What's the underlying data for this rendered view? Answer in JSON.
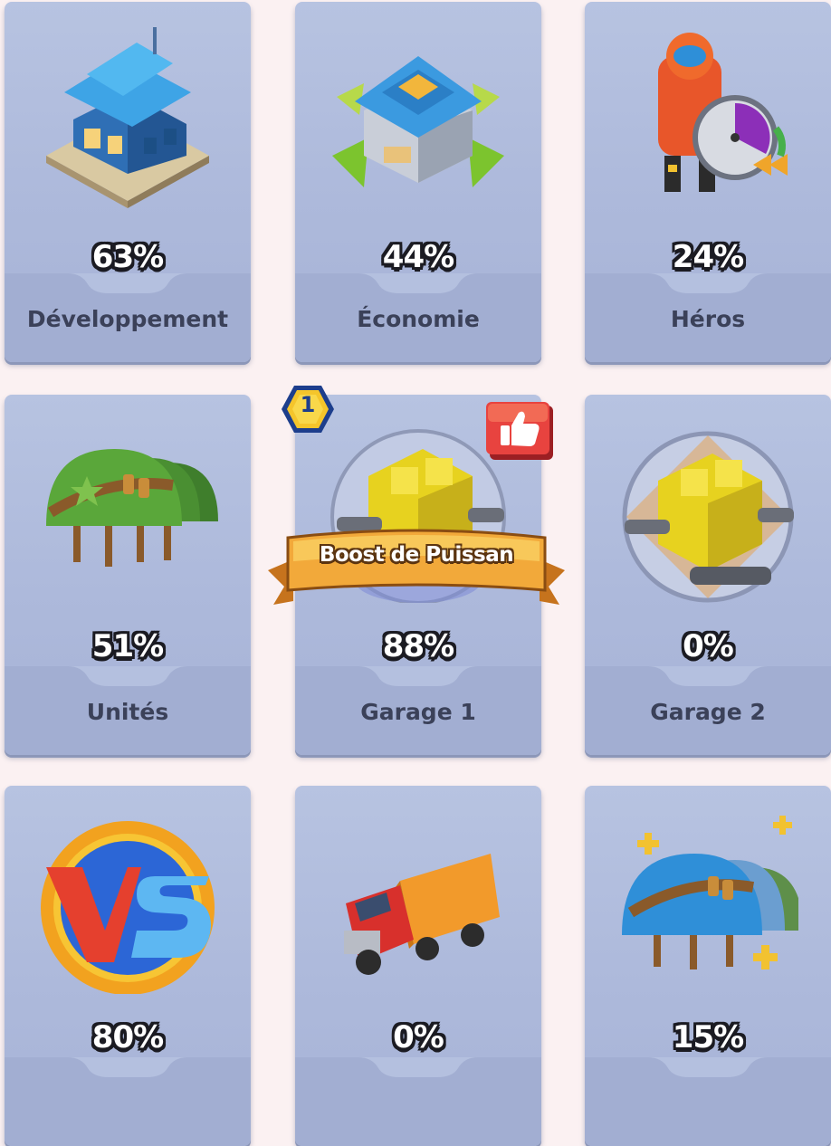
{
  "cards": [
    {
      "id": "developpement",
      "percent": "63%",
      "label": "Développement",
      "icon": "building-icon"
    },
    {
      "id": "economie",
      "percent": "44%",
      "label": "Économie",
      "icon": "headquarters-expand-icon"
    },
    {
      "id": "heros",
      "percent": "24%",
      "label": "Héros",
      "icon": "hero-speedup-icon"
    },
    {
      "id": "unites",
      "percent": "51%",
      "label": "Unités",
      "icon": "soldier-helmets-icon"
    },
    {
      "id": "garage1",
      "percent": "88%",
      "label": "Garage 1",
      "icon": "tank-garage-icon"
    },
    {
      "id": "garage2",
      "percent": "0%",
      "label": "Garage 2",
      "icon": "tank-garage-icon"
    },
    {
      "id": "vs",
      "percent": "80%",
      "label": "",
      "icon": "versus-icon"
    },
    {
      "id": "transport",
      "percent": "0%",
      "label": "",
      "icon": "truck-icon"
    },
    {
      "id": "unites-boost",
      "percent": "15%",
      "label": "",
      "icon": "helmets-plus-icon"
    }
  ],
  "overlay": {
    "level_badge": "1",
    "banner_text": "Boost de Puissan",
    "recommended_icon": "thumbs-up-icon"
  },
  "colors": {
    "background": "#fbf1f2",
    "card": "#b2bfdf",
    "label": "#3b4159",
    "banner": "#f2a93a",
    "badge": "#f5c52b",
    "like": "#e8433f"
  }
}
